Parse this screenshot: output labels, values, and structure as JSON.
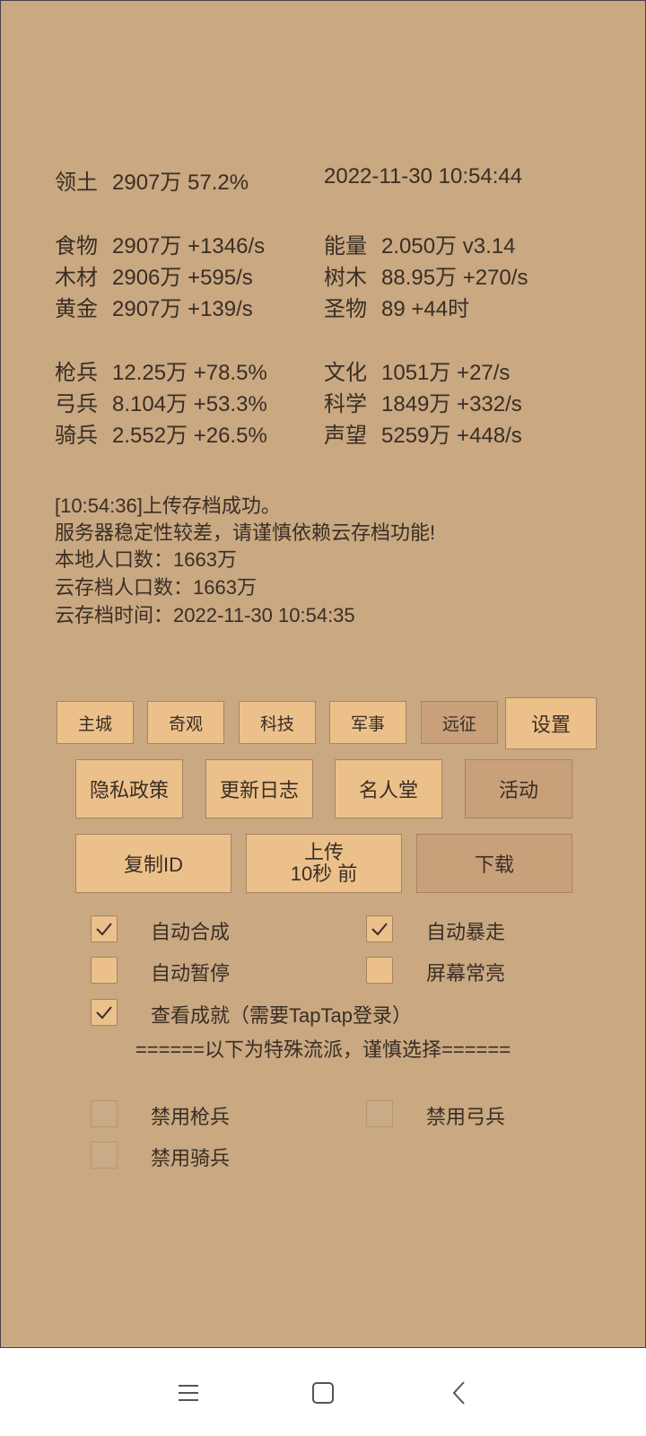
{
  "stats": {
    "territory": {
      "label": "领土",
      "value": "2907万  57.2%"
    },
    "datetime": "2022-11-30 10:54:44",
    "left": [
      {
        "label": "食物",
        "value": "2907万 +1346/s"
      },
      {
        "label": "木材",
        "value": "2906万 +595/s"
      },
      {
        "label": "黄金",
        "value": "2907万 +139/s"
      },
      {
        "label": "枪兵",
        "value": "12.25万 +78.5%"
      },
      {
        "label": "弓兵",
        "value": "8.104万 +53.3%"
      },
      {
        "label": "骑兵",
        "value": "2.552万 +26.5%"
      }
    ],
    "right": [
      {
        "label": "能量",
        "value": "2.050万  v3.14"
      },
      {
        "label": "树木",
        "value": "88.95万 +270/s"
      },
      {
        "label": "圣物",
        "value": "89 +44时"
      },
      {
        "label": "文化",
        "value": "1051万 +27/s"
      },
      {
        "label": "科学",
        "value": "1849万 +332/s"
      },
      {
        "label": "声望",
        "value": "5259万 +448/s"
      }
    ]
  },
  "log": [
    "[10:54:36]上传存档成功。",
    "服务器稳定性较差，请谨慎依赖云存档功能!",
    "本地人口数：1663万",
    "云存档人口数：1663万",
    "云存档时间：2022-11-30 10:54:35"
  ],
  "tabs": [
    "主城",
    "奇观",
    "科技",
    "军事",
    "远征",
    "设置"
  ],
  "menu_buttons": [
    "隐私政策",
    "更新日志",
    "名人堂",
    "活动"
  ],
  "cloud_buttons": {
    "copy_id": "复制ID",
    "upload_line1": "上传",
    "upload_line2": "10秒 前",
    "download": "下载"
  },
  "options": {
    "auto_merge": {
      "label": "自动合成",
      "checked": true
    },
    "auto_rampage": {
      "label": "自动暴走",
      "checked": true
    },
    "auto_pause": {
      "label": "自动暂停",
      "checked": false
    },
    "screen_on": {
      "label": "屏幕常亮",
      "checked": false
    },
    "view_achievements": {
      "label": "查看成就（需要TapTap登录）",
      "checked": true
    }
  },
  "special_divider": "======以下为特殊流派，谨慎选择======",
  "special_options": {
    "disable_spear": {
      "label": "禁用枪兵",
      "checked": false
    },
    "disable_bow": {
      "label": "禁用弓兵",
      "checked": false
    },
    "disable_cavalry": {
      "label": "禁用骑兵",
      "checked": false
    }
  },
  "icons": {
    "nav_menu": "menu-icon",
    "nav_home": "home-square-icon",
    "nav_back": "back-chevron-icon",
    "check": "checkmark-icon"
  },
  "colors": {
    "panel_bg": "#c9a882",
    "button_bg": "#ecc08b",
    "button_active_bg": "#c8a07a",
    "text": "#3a2e24"
  }
}
